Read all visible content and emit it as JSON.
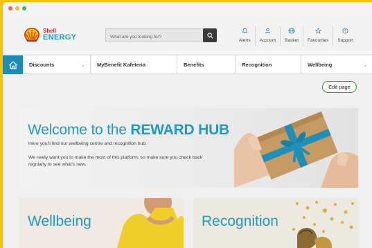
{
  "brand": {
    "shell": "Shell",
    "energy": "ENERGY"
  },
  "search": {
    "placeholder": "What are you looking for?"
  },
  "actions": [
    {
      "label": "Alerts",
      "icon": "bell-icon"
    },
    {
      "label": "Account",
      "icon": "user-icon"
    },
    {
      "label": "Basket",
      "icon": "basket-icon"
    },
    {
      "label": "Favourites",
      "icon": "star-icon"
    },
    {
      "label": "Support",
      "icon": "help-icon"
    }
  ],
  "nav": [
    {
      "label": "Discounts",
      "chevron": "⌄"
    },
    {
      "label": "MyBenefit Kafeteria",
      "chevron": ""
    },
    {
      "label": "Benefits",
      "chevron": ""
    },
    {
      "label": "Recognition",
      "chevron": ""
    },
    {
      "label": "Wellbeing",
      "chevron": "⌄"
    }
  ],
  "edit": {
    "label": "Edit page"
  },
  "hero": {
    "title_pre": "Welcome to the ",
    "title_bold": "REWARD HUB",
    "sub": "Here you'll find our wellbeing centre and recognition hub.",
    "body": "We really want you to make the most of this platform, so make sure you check back regularly to see what's new."
  },
  "cards": {
    "wellbeing": "Wellbeing",
    "recognition": "Recognition"
  },
  "colors": {
    "accent": "#1e9ac6",
    "nav_home": "#1e8bb8",
    "edit_border": "#3a9b3a",
    "frame": "#f6c400"
  }
}
